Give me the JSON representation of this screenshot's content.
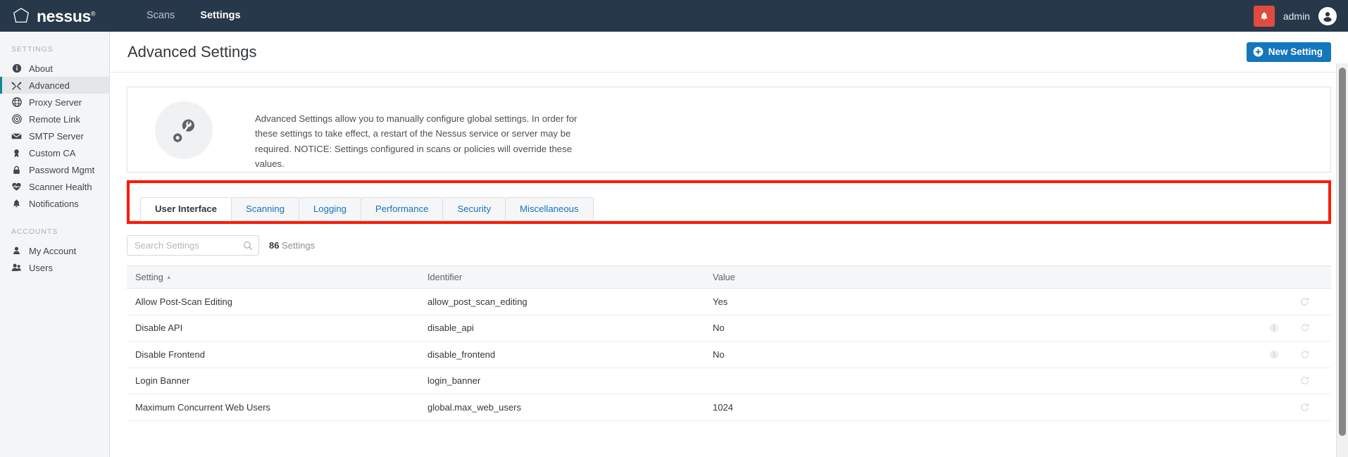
{
  "topnav": {
    "brand": "nessus",
    "brand_tm": "®",
    "links": [
      {
        "label": "Scans",
        "active": false
      },
      {
        "label": "Settings",
        "active": true
      }
    ],
    "notifications_icon": "bell-icon",
    "notifications_color": "#e04b3f",
    "username": "admin",
    "avatar_icon": "user-avatar-icon",
    "background_color": "#27384a"
  },
  "sidebar": {
    "groups": [
      {
        "label": "SETTINGS",
        "items": [
          {
            "label": "About",
            "icon": "info-circle-icon",
            "active": false
          },
          {
            "label": "Advanced",
            "icon": "tools-icon",
            "active": true
          },
          {
            "label": "Proxy Server",
            "icon": "globe-icon",
            "active": false
          },
          {
            "label": "Remote Link",
            "icon": "target-icon",
            "active": false
          },
          {
            "label": "SMTP Server",
            "icon": "envelope-icon",
            "active": false
          },
          {
            "label": "Custom CA",
            "icon": "certificate-icon",
            "active": false
          },
          {
            "label": "Password Mgmt",
            "icon": "lock-icon",
            "active": false
          },
          {
            "label": "Scanner Health",
            "icon": "heartbeat-icon",
            "active": false
          },
          {
            "label": "Notifications",
            "icon": "bell-icon",
            "active": false
          }
        ]
      },
      {
        "label": "ACCOUNTS",
        "items": [
          {
            "label": "My Account",
            "icon": "user-icon",
            "active": false
          },
          {
            "label": "Users",
            "icon": "users-icon",
            "active": false
          }
        ]
      }
    ],
    "active_accent_color": "#0d8896"
  },
  "page": {
    "title": "Advanced Settings",
    "new_setting_button": "New Setting",
    "new_setting_icon": "plus-circle-icon",
    "new_setting_color": "#1476bc"
  },
  "info_panel": {
    "icon": "gears-wrench-icon",
    "text": "Advanced Settings allow you to manually configure global settings. In order for these settings to take effect, a restart of the Nessus service or server may be required. NOTICE: Settings configured in scans or policies will override these values."
  },
  "tabs": {
    "highlight_color": "#fb1b06",
    "items": [
      {
        "label": "User Interface",
        "active": true
      },
      {
        "label": "Scanning",
        "active": false
      },
      {
        "label": "Logging",
        "active": false
      },
      {
        "label": "Performance",
        "active": false
      },
      {
        "label": "Security",
        "active": false
      },
      {
        "label": "Miscellaneous",
        "active": false
      }
    ]
  },
  "search": {
    "placeholder": "Search Settings",
    "value": "",
    "icon": "search-icon",
    "count_number": "86",
    "count_label": "Settings"
  },
  "table": {
    "columns": [
      {
        "label": "Setting",
        "sorted": "asc"
      },
      {
        "label": "Identifier",
        "sorted": ""
      },
      {
        "label": "Value",
        "sorted": ""
      }
    ],
    "sort_caret": "▲",
    "rows": [
      {
        "setting": "Allow Post-Scan Editing",
        "identifier": "allow_post_scan_editing",
        "value": "Yes",
        "has_info": false,
        "has_refresh": true
      },
      {
        "setting": "Disable API",
        "identifier": "disable_api",
        "value": "No",
        "has_info": true,
        "has_refresh": true
      },
      {
        "setting": "Disable Frontend",
        "identifier": "disable_frontend",
        "value": "No",
        "has_info": true,
        "has_refresh": true
      },
      {
        "setting": "Login Banner",
        "identifier": "login_banner",
        "value": "",
        "has_info": false,
        "has_refresh": true
      },
      {
        "setting": "Maximum Concurrent Web Users",
        "identifier": "global.max_web_users",
        "value": "1024",
        "has_info": false,
        "has_refresh": true
      }
    ]
  }
}
